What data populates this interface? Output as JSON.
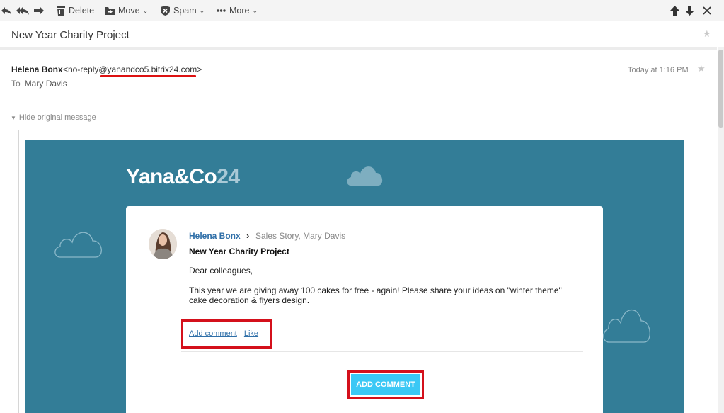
{
  "toolbar": {
    "delete_label": "Delete",
    "move_label": "Move",
    "spam_label": "Spam",
    "more_label": "More",
    "icons": [
      "reply-icon",
      "reply-all-icon",
      "forward-icon",
      "trash-icon",
      "folder-move-icon",
      "shield-icon",
      "ellipsis-icon",
      "arrow-up-icon",
      "arrow-down-icon",
      "close-icon"
    ]
  },
  "subject": "New Year Charity Project",
  "message": {
    "sender_name": "Helena Bonx",
    "sender_email": "<no-reply@yanandco5.bitrix24.com>",
    "to_label": "To",
    "to_name": "Mary Davis",
    "date": "Today at 1:16 PM",
    "toggle_label": "Hide original message"
  },
  "email_body": {
    "logo_text": "Yana&Co",
    "logo_number": "24",
    "post": {
      "author": "Helena Bonx",
      "destinations": "Sales Story, Mary Davis",
      "title": "New Year Charity Project",
      "greeting": "Dear colleagues,",
      "text": "This year we are giving away 100 cakes for free - again! Please share your ideas on \"winter theme\" cake decoration & flyers design.",
      "link_add_comment": "Add comment",
      "link_like": "Like",
      "button_label": "ADD COMMENT"
    }
  },
  "colors": {
    "banner": "#337d97",
    "button": "#3bc8f5",
    "link": "#2f6fa8",
    "highlight": "#d4101b",
    "toolbar_bg": "#f4f4f4"
  }
}
